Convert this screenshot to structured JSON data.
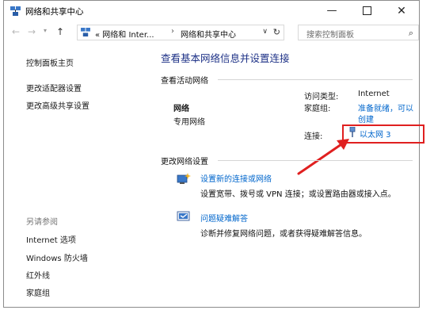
{
  "window": {
    "title": "网络和共享中心"
  },
  "nav": {
    "back": "←",
    "forward": "→",
    "up": "↑"
  },
  "address": {
    "crumb1": "« 网络和 Inter...",
    "crumb2": "网络和共享中心",
    "sep": "›"
  },
  "search": {
    "placeholder": "搜索控制面板"
  },
  "sidebar": {
    "home": "控制面板主页",
    "adapter": "更改适配器设置",
    "sharing": "更改高级共享设置",
    "see_also": "另请参阅",
    "links": [
      "Internet 选项",
      "Windows 防火墙",
      "红外线",
      "家庭组"
    ]
  },
  "main": {
    "title": "查看基本网络信息并设置连接",
    "active_label": "查看活动网络",
    "network_name": "网络",
    "network_type": "专用网络",
    "access_key": "访问类型:",
    "access_val": "Internet",
    "homegroup_key": "家庭组:",
    "homegroup_val1": "准备就绪，可以",
    "homegroup_val2": "创建",
    "conn_key": "连接:",
    "conn_val": "以太网 3",
    "change_label": "更改网络设置",
    "task1_link": "设置新的连接或网络",
    "task1_desc": "设置宽带、拨号或 VPN 连接；或设置路由器或接入点。",
    "task2_link": "问题疑难解答",
    "task2_desc": "诊断并修复网络问题，或者获得疑难解答信息。"
  },
  "colors": {
    "link": "#0066cc",
    "title": "#1e3287",
    "highlight": "#e02020"
  }
}
